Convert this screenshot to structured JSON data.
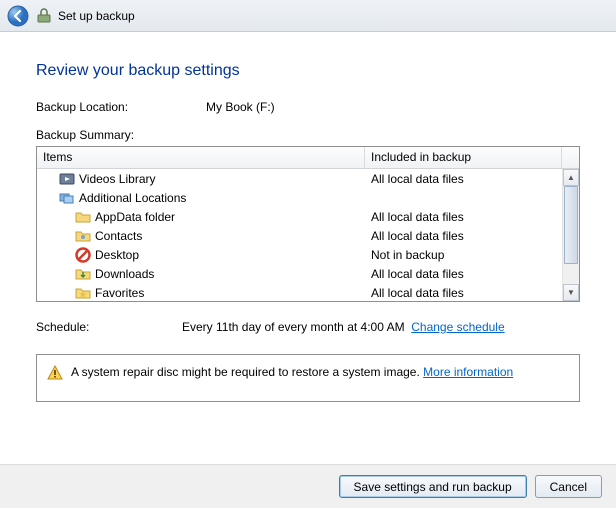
{
  "titlebar": {
    "title": "Set up backup"
  },
  "heading": "Review your backup settings",
  "location": {
    "label": "Backup Location:",
    "value": "My Book (F:)"
  },
  "summary_label": "Backup Summary:",
  "columns": {
    "items": "Items",
    "included": "Included in backup"
  },
  "rows": [
    {
      "icon": "videos-library-icon",
      "indent": 1,
      "name": "Videos Library",
      "included": "All local data files"
    },
    {
      "icon": "folder-group-icon",
      "indent": 1,
      "name": "Additional Locations",
      "included": ""
    },
    {
      "icon": "folder-icon",
      "indent": 2,
      "name": "AppData folder",
      "included": "All local data files"
    },
    {
      "icon": "contacts-icon",
      "indent": 2,
      "name": "Contacts",
      "included": "All local data files"
    },
    {
      "icon": "blocked-icon",
      "indent": 2,
      "name": "Desktop",
      "included": "Not in backup"
    },
    {
      "icon": "downloads-icon",
      "indent": 2,
      "name": "Downloads",
      "included": "All local data files"
    },
    {
      "icon": "favorites-icon",
      "indent": 2,
      "name": "Favorites",
      "included": "All local data files"
    }
  ],
  "schedule": {
    "label": "Schedule:",
    "value": "Every 11th day of every month at 4:00 AM",
    "change_link": "Change schedule"
  },
  "warning": {
    "text": "A system repair disc might be required to restore a system image.",
    "link": "More information"
  },
  "buttons": {
    "save": "Save settings and run backup",
    "cancel": "Cancel"
  }
}
